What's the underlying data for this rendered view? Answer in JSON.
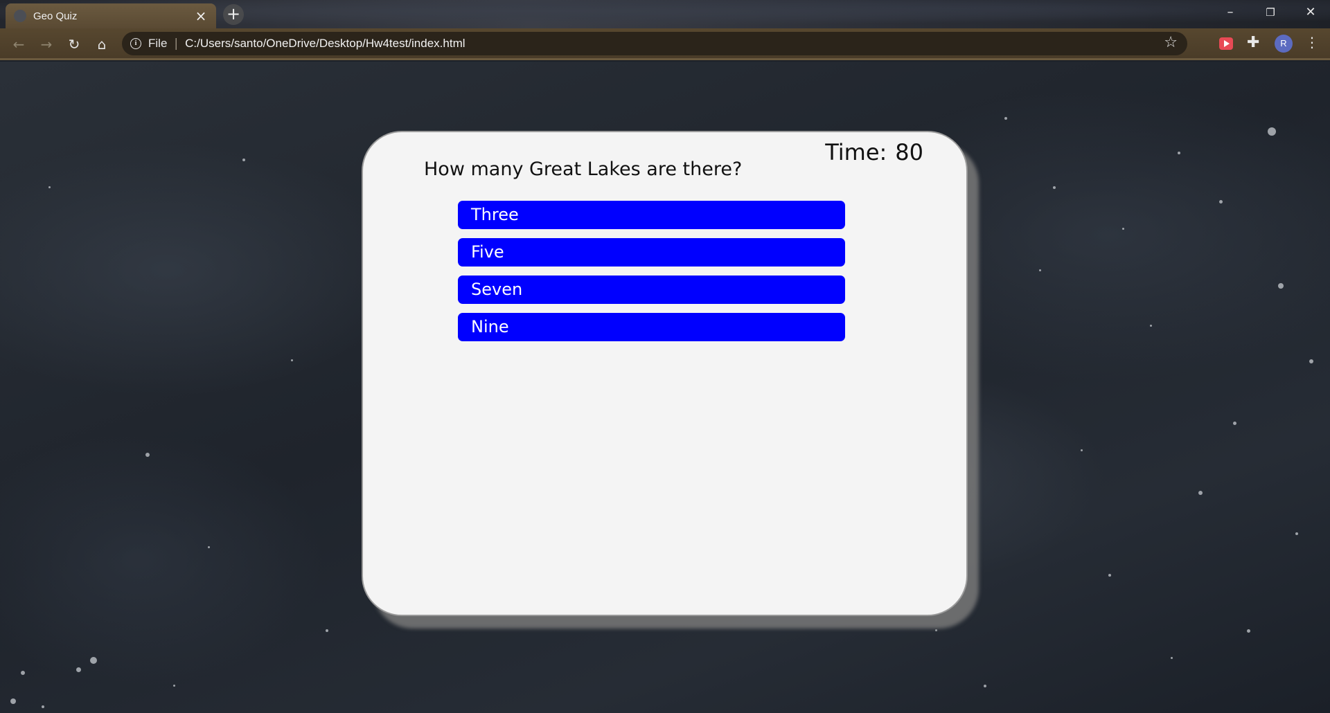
{
  "browser": {
    "tab_title": "Geo Quiz",
    "tab_close": "×",
    "new_tab": "+",
    "window_controls": {
      "minimize": "–",
      "restore": "❐",
      "close": "✕"
    },
    "nav": {
      "back": "←",
      "forward": "→",
      "reload": "↻",
      "home": "⌂"
    },
    "omnibox": {
      "scheme_label": "File",
      "separator": "|",
      "url": "C:/Users/santo/OneDrive/Desktop/Hw4test/index.html"
    },
    "bookmark_star": "☆",
    "extensions_icon": "✚",
    "profile_initial": "R",
    "menu": "⋮"
  },
  "quiz": {
    "timer_label": "Time:",
    "timer_value": "80",
    "question": "How many Great Lakes are there?",
    "answers": [
      "Three",
      "Five",
      "Seven",
      "Nine"
    ],
    "answer_color": "#0000ff"
  }
}
